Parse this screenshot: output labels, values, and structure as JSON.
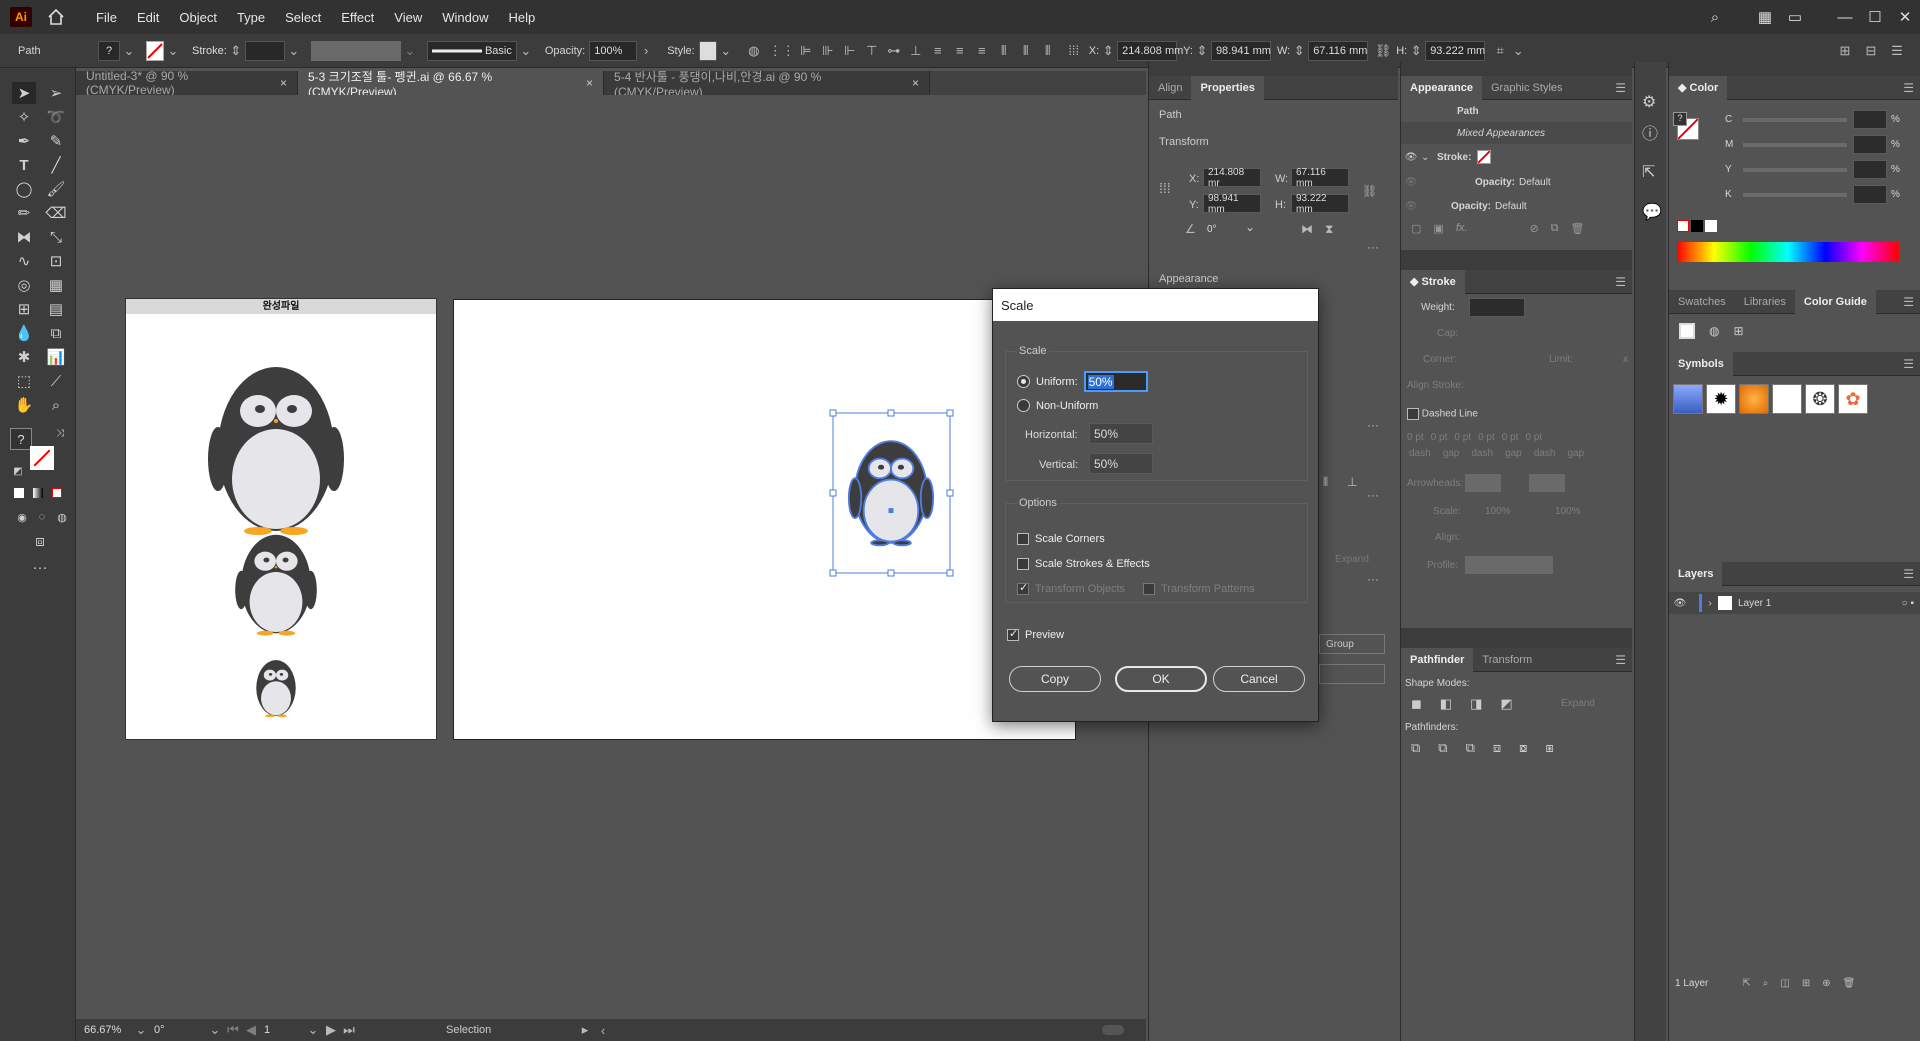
{
  "app": {
    "logo": "Ai"
  },
  "menu": [
    "File",
    "Edit",
    "Object",
    "Type",
    "Select",
    "Effect",
    "View",
    "Window",
    "Help"
  ],
  "control": {
    "kind": "Path",
    "stroke_label": "Stroke:",
    "brush": "Basic",
    "opacity_label": "Opacity:",
    "opacity": "100%",
    "style_label": "Style:",
    "x_label": "X:",
    "x": "214.808 mm",
    "y_label": "Y:",
    "y": "98.941 mm",
    "w_label": "W:",
    "w": "67.116 mm",
    "h_label": "H:",
    "h": "93.222 mm"
  },
  "tabs": [
    {
      "label": "Untitled-3* @ 90 % (CMYK/Preview)"
    },
    {
      "label": "5-3 크기조절 툴- 펭귄.ai @ 66.67 % (CMYK/Preview)"
    },
    {
      "label": "5-4 반사툴 - 풍댕이,나비,안경.ai @ 90 % (CMYK/Preview)"
    }
  ],
  "artboard1_title": "완성파일",
  "status": {
    "zoom": "66.67%",
    "rotation": "0°",
    "page": "1",
    "tool": "Selection"
  },
  "properties": {
    "tabs": [
      "Align",
      "Properties"
    ],
    "section_path": "Path",
    "section_transform": "Transform",
    "x_label": "X:",
    "x": "214.808 mr",
    "y_label": "Y:",
    "y": "98.941 mm",
    "w_label": "W:",
    "w": "67.116 mm",
    "h_label": "H:",
    "h": "93.222 mm",
    "angle": "0°",
    "section_appearance": "Appearance",
    "group_button": "Group"
  },
  "appearance": {
    "tabs": [
      "Appearance",
      "Graphic Styles"
    ],
    "path": "Path",
    "mixed": "Mixed Appearances",
    "stroke": "Stroke:",
    "opacity1_label": "Opacity:",
    "opacity1": "Default",
    "opacity2_label": "Opacity:",
    "opacity2": "Default"
  },
  "stroke_panel": {
    "title": "Stroke",
    "weight": "Weight:",
    "cap": "Cap:",
    "corner": "Corner:",
    "limit": "Limit:",
    "limit_x": "x",
    "align": "Align Stroke:",
    "dashed": "Dashed Line",
    "dash_vals": [
      "0 pt",
      "0 pt",
      "0 pt",
      "0 pt",
      "0 pt",
      "0 pt"
    ],
    "dash_labels": [
      "dash",
      "gap",
      "dash",
      "gap",
      "dash",
      "gap"
    ],
    "arrowheads": "Arrowheads:",
    "scale": "Scale:",
    "scale1": "100%",
    "scale2": "100%",
    "align2": "Align:",
    "profile": "Profile:"
  },
  "pathfinder": {
    "tabs": [
      "Pathfinder",
      "Transform"
    ],
    "shape_modes": "Shape Modes:",
    "expand": "Expand",
    "pathfinders": "Pathfinders:"
  },
  "color": {
    "title": "Color",
    "channels": [
      "C",
      "M",
      "Y",
      "K"
    ],
    "pct": "%"
  },
  "swatches_tabs": [
    "Swatches",
    "Libraries",
    "Color Guide"
  ],
  "symbols": {
    "title": "Symbols"
  },
  "layers": {
    "title": "Layers",
    "layer1": "Layer 1",
    "count": "1 Layer"
  },
  "dialog": {
    "title": "Scale",
    "scale_group": "Scale",
    "uniform_label": "Uniform:",
    "uniform_value": "50%",
    "non_uniform_label": "Non-Uniform",
    "horizontal_label": "Horizontal:",
    "horizontal_value": "50%",
    "vertical_label": "Vertical:",
    "vertical_value": "50%",
    "options_group": "Options",
    "scale_corners": "Scale Corners",
    "scale_strokes": "Scale Strokes & Effects",
    "transform_objects": "Transform Objects",
    "transform_patterns": "Transform Patterns",
    "preview": "Preview",
    "copy": "Copy",
    "ok": "OK",
    "cancel": "Cancel"
  }
}
